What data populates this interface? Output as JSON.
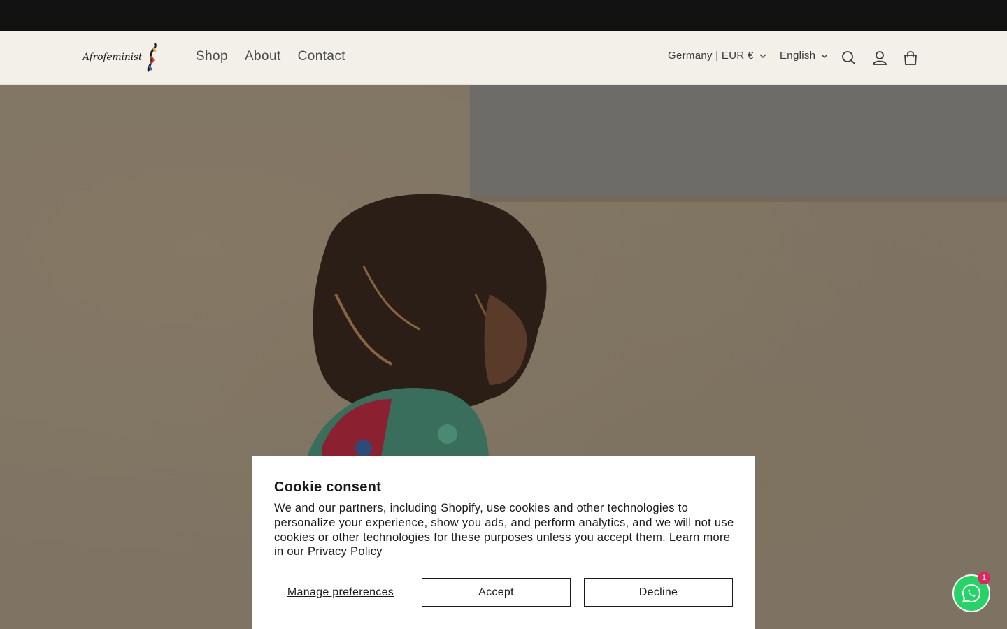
{
  "header": {
    "logo_text": "Afrofeminist",
    "nav": [
      {
        "label": "Shop"
      },
      {
        "label": "About"
      },
      {
        "label": "Contact"
      }
    ],
    "country_selector": "Germany | EUR €",
    "language_selector": "English",
    "icons": [
      "search-icon",
      "account-icon",
      "cart-icon"
    ]
  },
  "consent": {
    "title": "Cookie consent",
    "body": "We and our partners, including Shopify, use cookies and other technologies to personalize your experience, show you ads, and perform analytics, and we will not use cookies or other technologies for these purposes unless you accept them. Learn more in our ",
    "privacy_link": "Privacy Policy",
    "manage_label": "Manage preferences",
    "accept_label": "Accept",
    "decline_label": "Decline"
  },
  "whatsapp": {
    "badge_count": "1"
  },
  "colors": {
    "announcement_bar": "#121212",
    "header_bg": "#f3efe9",
    "whatsapp_green": "#25d366",
    "badge_red": "#e0245e"
  }
}
